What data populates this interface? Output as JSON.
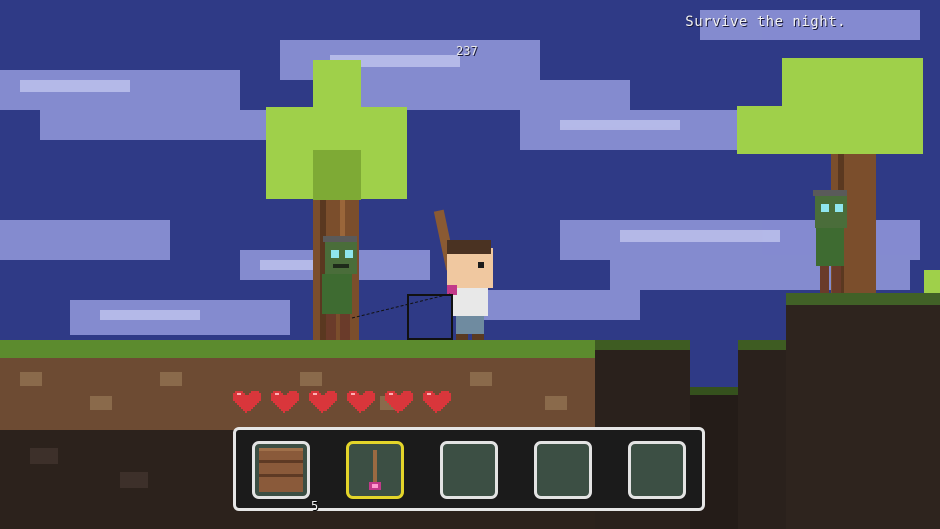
{
  "hud": {
    "objective": "Survive the night.",
    "score": "237"
  },
  "player": {
    "hearts": 6,
    "hearts_icon": "heart-icon"
  },
  "hotbar": {
    "selected_index": 1,
    "slots": [
      {
        "item": "wood-planks-icon",
        "count": "5"
      },
      {
        "item": "wooden-staff-icon",
        "count": ""
      },
      {
        "item": "",
        "count": ""
      },
      {
        "item": "",
        "count": ""
      },
      {
        "item": "",
        "count": ""
      }
    ]
  },
  "colors": {
    "sky": "#2f3a86",
    "cloud": "#8e94d8",
    "grass": "#5c8b2e",
    "dirt": "#6d4b33",
    "deep_dirt": "#2c221c",
    "leaf": "#9fd04a",
    "trunk": "#7b4e2c",
    "heart": "#d9363b",
    "hotbar_border": "#e6e6e6",
    "selected_border": "#e4d52a"
  }
}
